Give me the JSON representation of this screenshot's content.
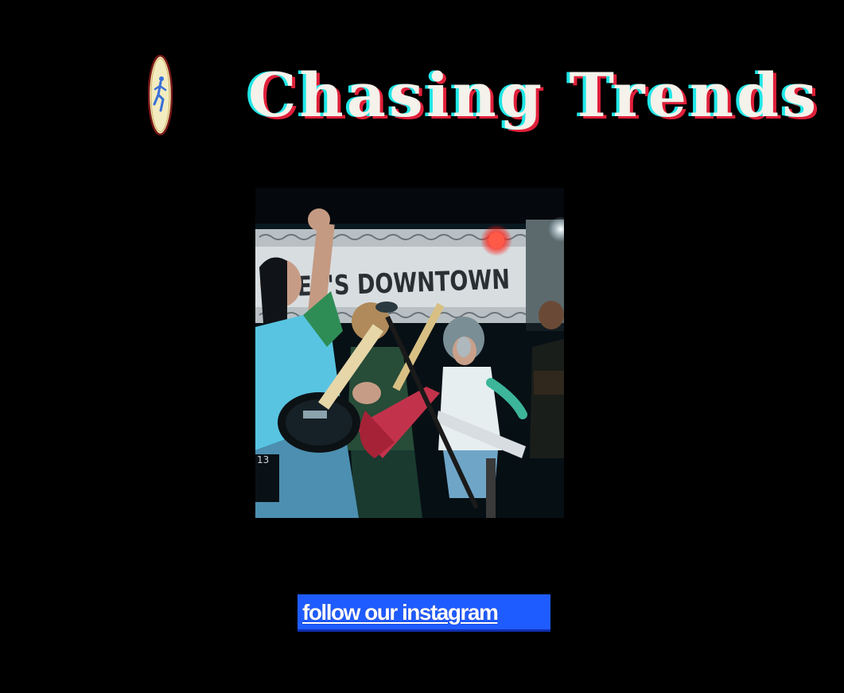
{
  "header": {
    "logo_icon": "running-man-badge-icon",
    "title": "Chasing Trends"
  },
  "photo": {
    "banner_text": "OSEY'S DOWNTOWN",
    "colors": {
      "background": "#000000",
      "title_fill": "#f4f2ea",
      "title_cyan_offset": "#20e6e6",
      "title_red_offset": "#e0203a"
    }
  },
  "instagram": {
    "label": "follow our instagram",
    "button_color": "#1f5cff"
  }
}
